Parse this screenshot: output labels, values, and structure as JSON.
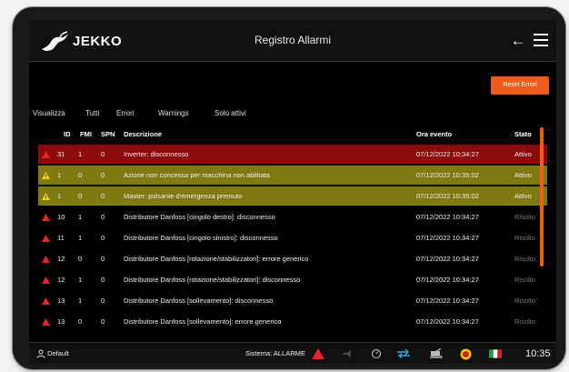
{
  "app": {
    "logo_text": "JEKKO",
    "title": "Registro Allarmi"
  },
  "toolbar": {
    "reset_label": "Reset Errori"
  },
  "filters": [
    {
      "label": "Visualizza"
    },
    {
      "label": "Tutti"
    },
    {
      "label": "Errori"
    },
    {
      "label": "Warnings"
    },
    {
      "label": "Solo attivi"
    }
  ],
  "columns": {
    "id": "ID",
    "fmi": "FMI",
    "spn": "SPN",
    "desc": "Descrizione",
    "time": "Ora evento",
    "state": "Stato"
  },
  "rows": [
    {
      "level": "error",
      "active": true,
      "id": "31",
      "fmi": "1",
      "spn": "0",
      "desc": "Inverter: disconnesso",
      "time": "07/12/2022 10:34:27",
      "state": "Attivo"
    },
    {
      "level": "warning",
      "active": true,
      "id": "1",
      "fmi": "0",
      "spn": "0",
      "desc": "Azione non concessa per macchina non abilitata",
      "time": "07/12/2022 10:35:02",
      "state": "Attivo"
    },
    {
      "level": "warning",
      "active": true,
      "id": "1",
      "fmi": "0",
      "spn": "0",
      "desc": "Master: pulsante d'emergenza premuto",
      "time": "07/12/2022 10:35:02",
      "state": "Attivo"
    },
    {
      "level": "error",
      "active": false,
      "id": "10",
      "fmi": "1",
      "spn": "0",
      "desc": "Distributore Danfoss [cingolo destro]: disconnesso",
      "time": "07/12/2022 10:34:27",
      "state": "Risolto"
    },
    {
      "level": "error",
      "active": false,
      "id": "11",
      "fmi": "1",
      "spn": "0",
      "desc": "Distributore Danfoss [cingolo sinistro]: disconnesso",
      "time": "07/12/2022 10:34:27",
      "state": "Risolto"
    },
    {
      "level": "error",
      "active": false,
      "id": "12",
      "fmi": "0",
      "spn": "0",
      "desc": "Distributore Danfoss [rotazione/stabilizzatori]: errore generico",
      "time": "07/12/2022 10:34:27",
      "state": "Risolto"
    },
    {
      "level": "error",
      "active": false,
      "id": "12",
      "fmi": "1",
      "spn": "0",
      "desc": "Distributore Danfoss [rotazione/stabilizzatori]: disconnesso",
      "time": "07/12/2022 10:34:27",
      "state": "Risolto"
    },
    {
      "level": "error",
      "active": false,
      "id": "13",
      "fmi": "1",
      "spn": "0",
      "desc": "Distributore Danfoss [sollevamento]: disconnesso",
      "time": "07/12/2022 10:34:27",
      "state": "Risolto"
    },
    {
      "level": "error",
      "active": false,
      "id": "13",
      "fmi": "0",
      "spn": "0",
      "desc": "Distributore Danfoss [sollevamento]: errore generico",
      "time": "07/12/2022 10:34:27",
      "state": "Risolto"
    }
  ],
  "statusbar": {
    "user": "Default",
    "system_label": "Sistema: ALLARME",
    "clock": "10:35"
  },
  "colors": {
    "accent": "#ee5d1c",
    "error_row": "#8c0a0a",
    "warning_row": "#7e7b12",
    "error_icon": "#e8222b",
    "warning_icon": "#f0d800",
    "resolved_text": "#7a7a7a"
  },
  "icons": [
    "jekko-logo",
    "back-arrow-icon",
    "menu-icon",
    "warning-triangle-icon",
    "user-icon",
    "alarm-icon",
    "speedometer-icon",
    "transfer-arrows-icon",
    "machine-icon",
    "emergency-button-icon",
    "italy-flag-icon"
  ]
}
